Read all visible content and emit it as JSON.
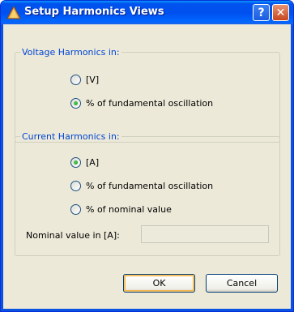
{
  "window": {
    "title": "Setup Harmonics Views",
    "help_glyph": "?",
    "close_glyph": "✕"
  },
  "voltage_group": {
    "legend": "Voltage Harmonics in:",
    "options": [
      {
        "label": "[V]",
        "checked": false
      },
      {
        "label": "% of fundamental oscillation",
        "checked": true
      }
    ]
  },
  "current_group": {
    "legend": "Current Harmonics in:",
    "options": [
      {
        "label": "[A]",
        "checked": true
      },
      {
        "label": "% of fundamental oscillation",
        "checked": false
      },
      {
        "label": "% of nominal value",
        "checked": false
      }
    ],
    "nominal_label": "Nominal value in [A]:",
    "nominal_value": ""
  },
  "buttons": {
    "ok_label": "OK",
    "cancel_label": "Cancel"
  },
  "icons": {
    "app_icon": "warning-triangle-icon"
  }
}
